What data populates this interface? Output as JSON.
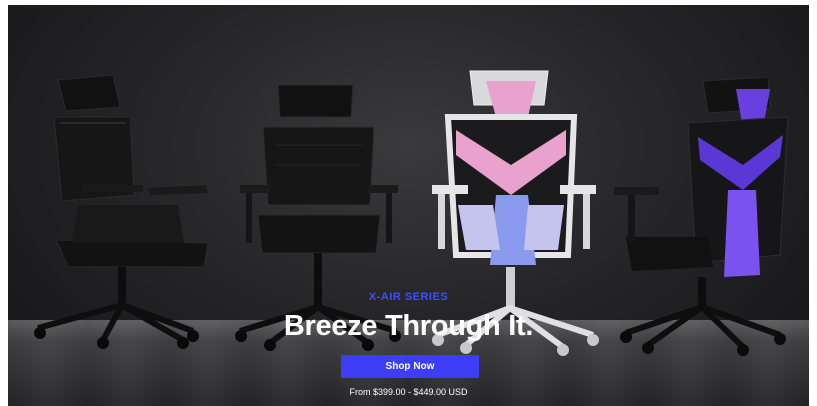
{
  "hero": {
    "series_label": "X-AIR SERIES",
    "headline": "Breeze Through It.",
    "cta_label": "Shop Now",
    "price_range": "From $399.00 - $449.00 USD"
  },
  "colors": {
    "accent": "#3d3df5",
    "series_text": "#3f4dff",
    "background_dark": "#1e1e20",
    "chair_white_frame": "#e6e6e8",
    "chair_pink": "#e8a2cd",
    "chair_purple": "#6a3fe0"
  },
  "products_pictured": [
    "black-mesh-chair",
    "black-mesh-chair",
    "white-pink-chair",
    "black-purple-chair"
  ]
}
